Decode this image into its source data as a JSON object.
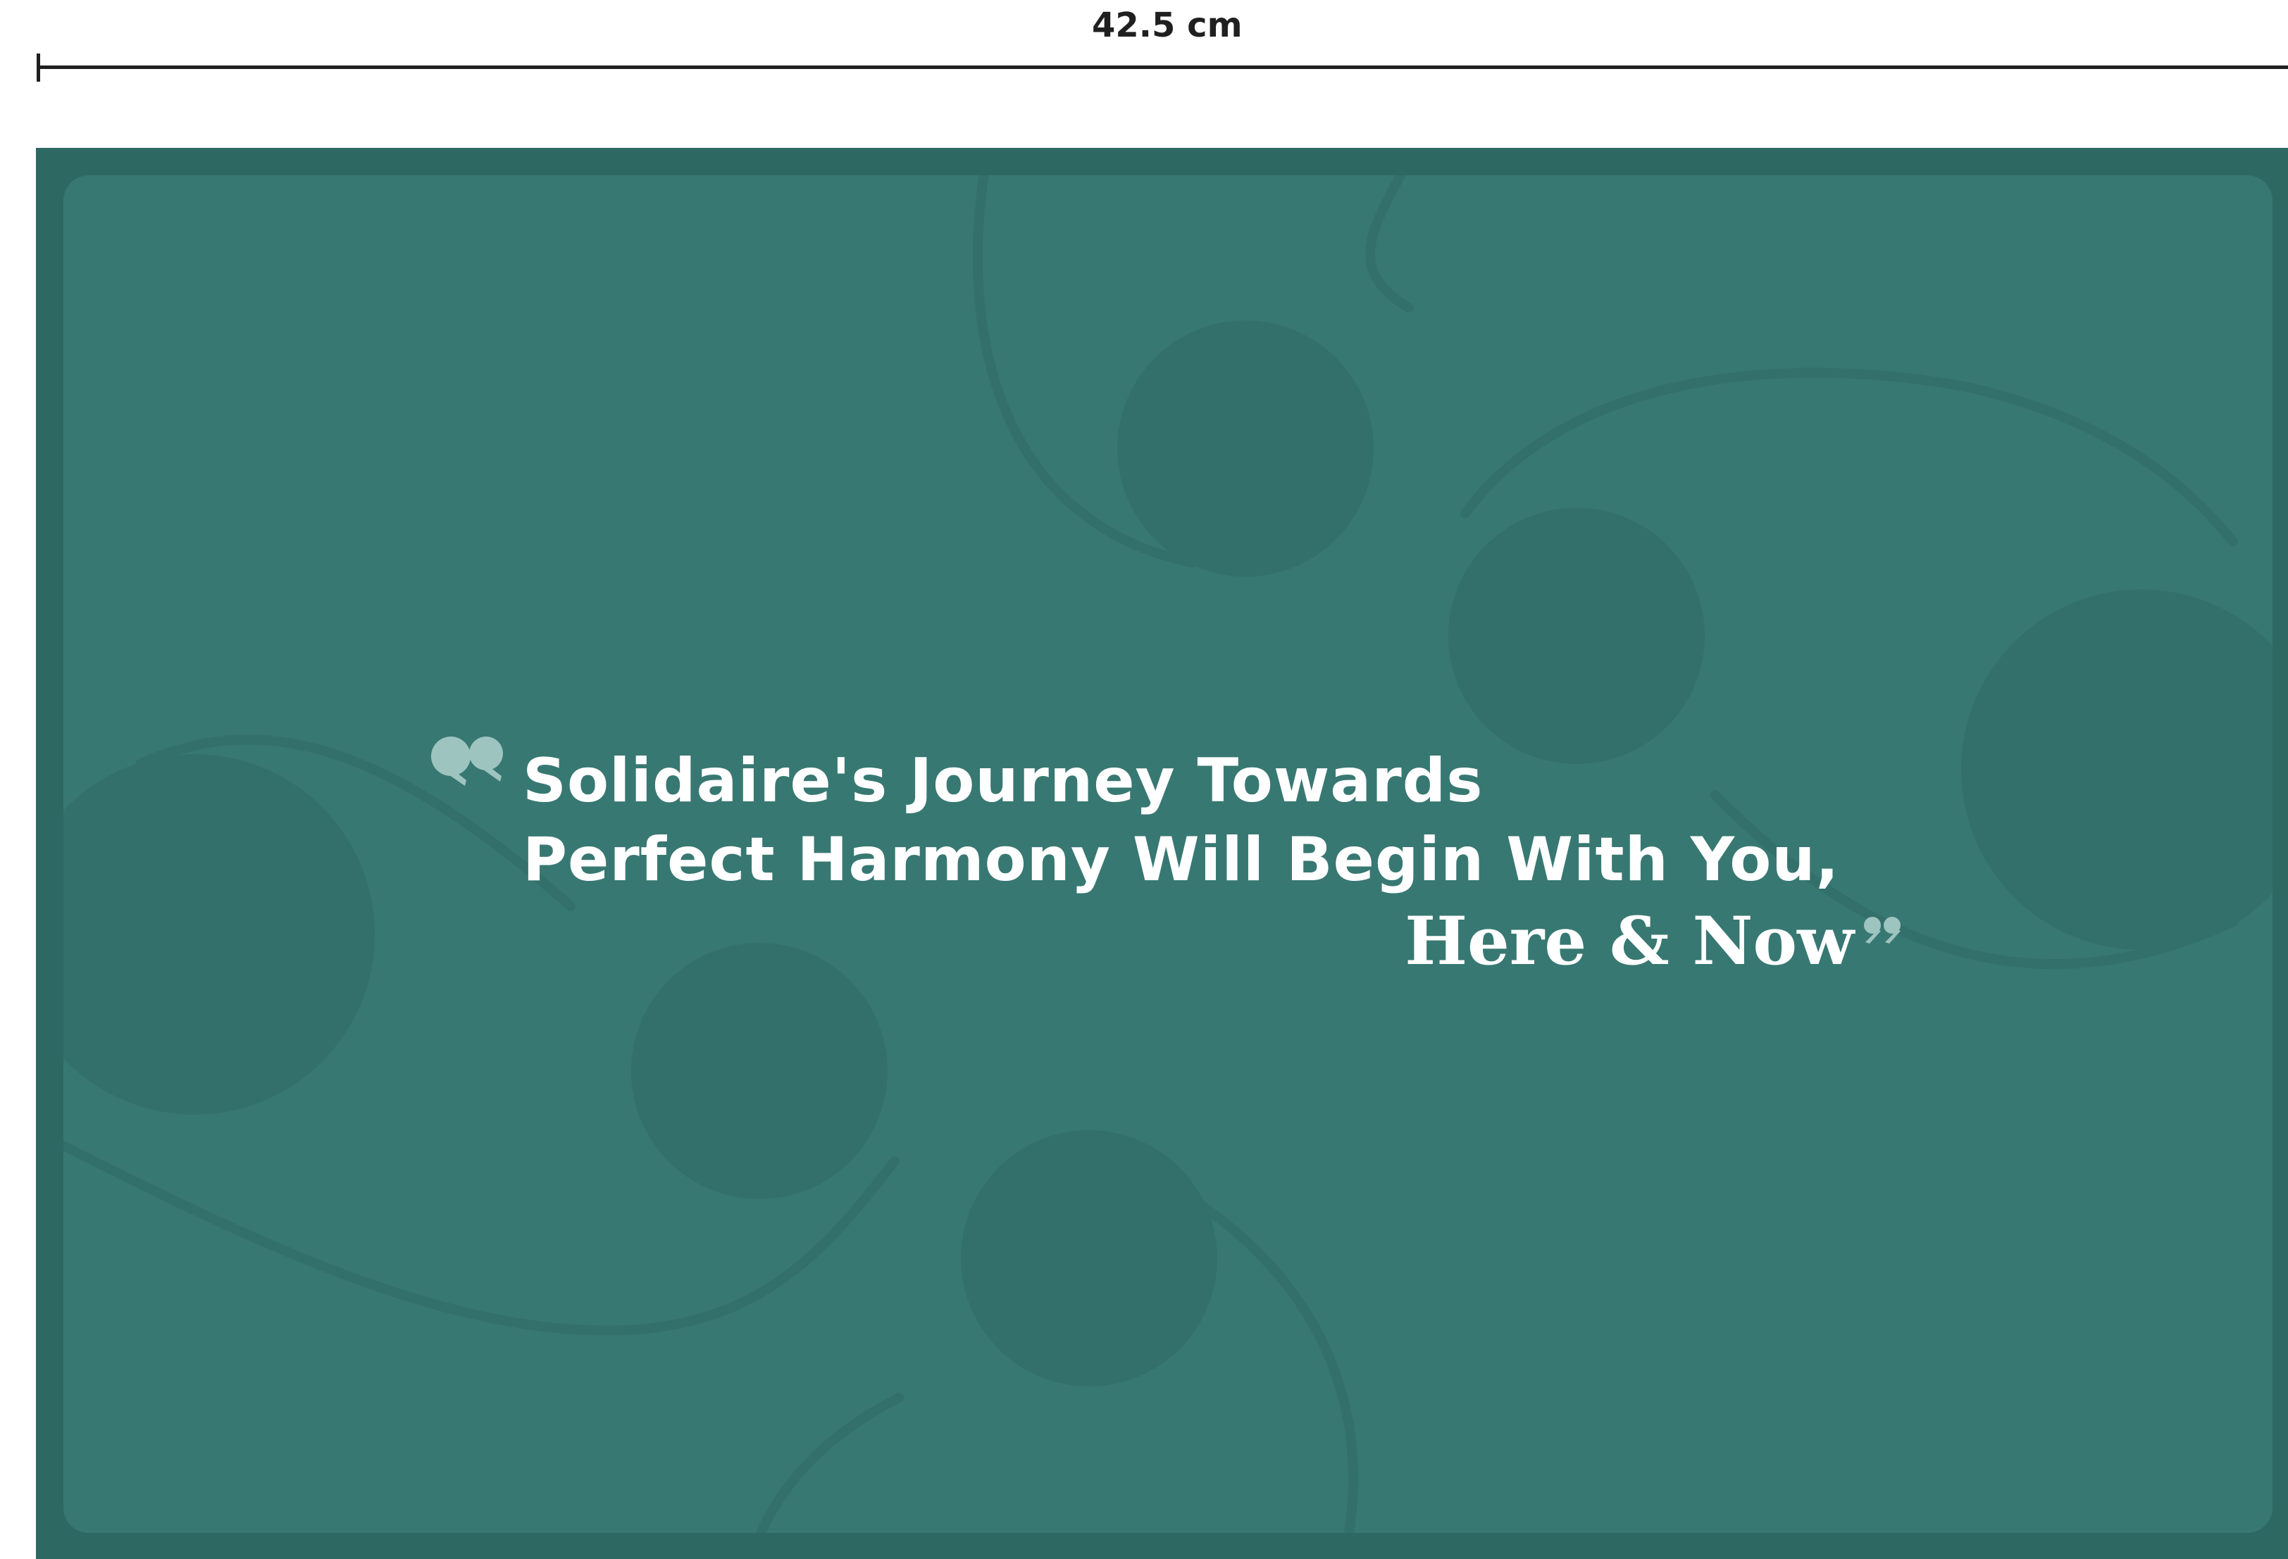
{
  "dimension_label": "42.5 cm",
  "quote": {
    "line1": "Solidaire's Journey Towards",
    "line2": "Perfect Harmony Will Begin With You,",
    "emphasis": "Here & Now"
  },
  "colors": {
    "frame": "#2e6863",
    "panel": "#387872",
    "circle": "#33706b",
    "quote_mark": "#9ec4bf",
    "text": "#ffffff",
    "ruler": "#1f1f1f"
  },
  "icons": {
    "open_quote": "open-quote-icon",
    "close_quote": "close-quote-icon"
  }
}
